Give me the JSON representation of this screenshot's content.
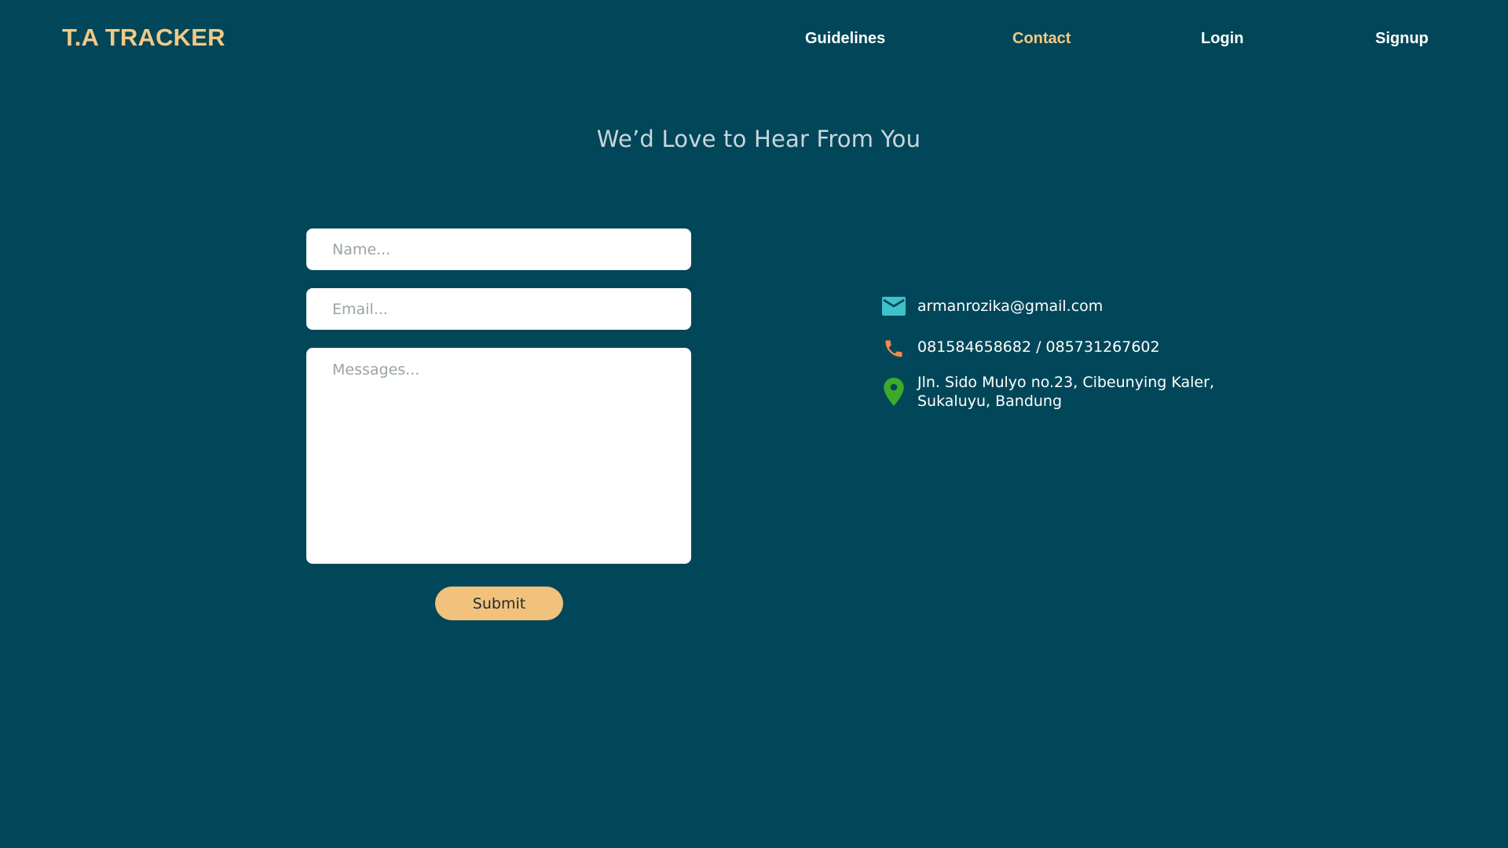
{
  "brand": "T.A TRACKER",
  "nav": {
    "guidelines": "Guidelines",
    "contact": "Contact",
    "login": "Login",
    "signup": "Signup",
    "active": "Contact"
  },
  "headline": "We’d Love to Hear From You",
  "form": {
    "name_placeholder": "Name...",
    "email_placeholder": "Email...",
    "message_placeholder": "Messages...",
    "submit_label": "Submit"
  },
  "contact_info": {
    "email": "armanrozika@gmail.com",
    "phone": "081584658682 / 085731267602",
    "address_line1": "Jln. Sido Mulyo no.23, Cibeunying Kaler,",
    "address_line2": "Sukaluyu, Bandung"
  },
  "icons": {
    "email": "mail-icon",
    "phone": "phone-icon",
    "address": "location-pin-icon"
  },
  "colors": {
    "background": "#024759",
    "accent": "#F2C986",
    "button": "#F2C27D",
    "mail_icon": "#3FC1C9",
    "phone_icon": "#F08B4A",
    "pin_icon": "#3DAA2A"
  }
}
